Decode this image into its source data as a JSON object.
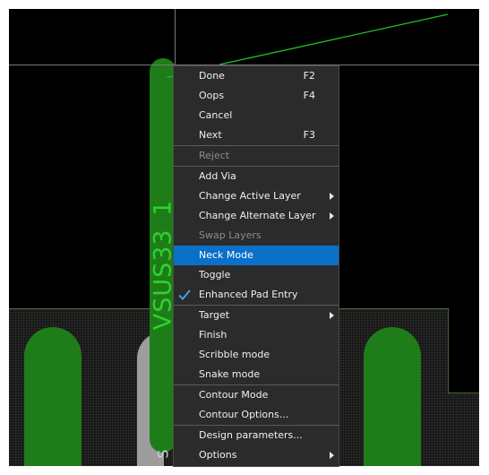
{
  "board": {
    "net_label": "VSUS33_1",
    "colors": {
      "copper": "#1e7d18",
      "net_text": "#2fd12f",
      "trace": "#22c022",
      "background": "#000000"
    }
  },
  "context_menu": {
    "items": [
      {
        "label": "Done",
        "shortcut": "F2"
      },
      {
        "label": "Oops",
        "shortcut": "F4"
      },
      {
        "label": "Cancel",
        "shortcut": ""
      },
      {
        "label": "Next",
        "shortcut": "F3"
      },
      {
        "label": "Reject",
        "state": "disabled"
      },
      {
        "label": "Add Via"
      },
      {
        "label": "Change Active Layer",
        "submenu": true
      },
      {
        "label": "Change Alternate Layer",
        "submenu": true
      },
      {
        "label": "Swap Layers",
        "state": "disabled"
      },
      {
        "label": "Neck Mode",
        "state": "highlighted"
      },
      {
        "label": "Toggle"
      },
      {
        "label": "Enhanced Pad Entry",
        "checked": true
      },
      {
        "label": "Target",
        "submenu": true
      },
      {
        "label": "Finish"
      },
      {
        "label": "Scribble mode"
      },
      {
        "label": "Snake mode"
      },
      {
        "label": "Contour Mode"
      },
      {
        "label": "Contour Options..."
      },
      {
        "label": "Design parameters..."
      },
      {
        "label": "Options",
        "submenu": true
      }
    ],
    "colors": {
      "background": "#2b2b2b",
      "highlight": "#0b70c8",
      "disabled_text": "#8c8c8c",
      "check": "#4aa3ff"
    }
  }
}
